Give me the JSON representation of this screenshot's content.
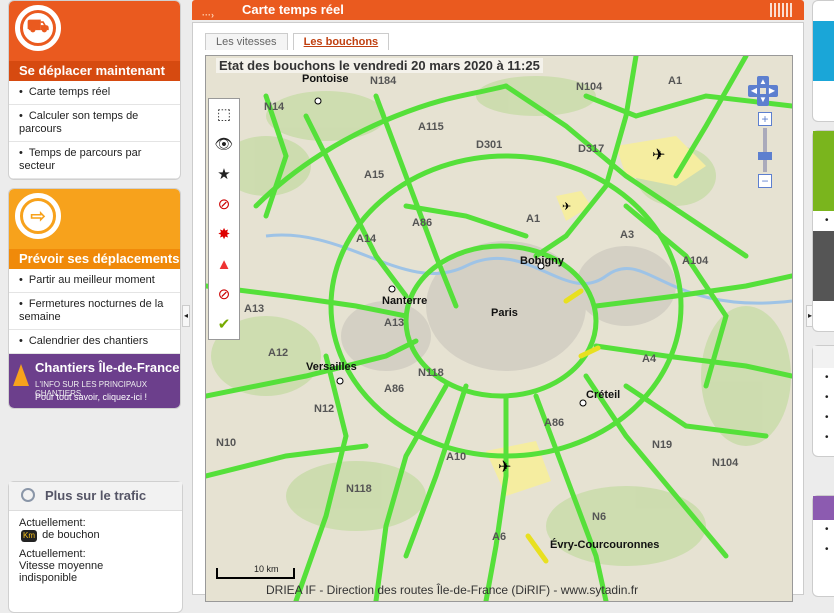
{
  "left_panel": {
    "move_now": {
      "title": "Se déplacer maintenant",
      "items": [
        "Carte temps réel",
        "Calculer son temps de parcours",
        "Temps de parcours par secteur"
      ]
    },
    "plan": {
      "title": "Prévoir ses déplacements",
      "items": [
        "Partir au meilleur moment",
        "Fermetures nocturnes de la semaine",
        "Calendrier des chantiers"
      ]
    },
    "banner": {
      "title": "Chantiers Île-de-France",
      "line1": "L'INFO SUR LES PRINCIPAUX CHANTIERS",
      "line2": "Pour tout savoir, cliquez-ici !"
    },
    "traffic": {
      "title": "Plus sur le trafic",
      "current1_label": "Actuellement:",
      "km_badge": "Km",
      "current1_text": "de bouchon",
      "current2_label": "Actuellement:",
      "current2_text1": "Vitesse moyenne",
      "current2_text2": "indisponible"
    }
  },
  "main": {
    "header_title": "Carte temps réel",
    "header_dots": "···›",
    "tabs": [
      "Les vitesses",
      "Les bouchons"
    ],
    "active_tab": "Les bouchons",
    "map_title": "Etat des bouchons le vendredi 20 mars 2020 à 11:25",
    "credit": "DRIEA IF - Direction des routes Île-de-France (DiRIF) - www.sytadin.fr",
    "scale_label": "10 km",
    "toolbar_icons": [
      "zoom-box-icon",
      "view-favorite-icon",
      "save-favorite-icon",
      "no-camera-icon",
      "incident-icon",
      "roadworks-cone-icon",
      "closure-icon",
      "check-icon"
    ],
    "places": [
      "Pontoise",
      "Bobigny",
      "Nanterre",
      "Paris",
      "Versailles",
      "Créteil",
      "Évry-Courcouronnes"
    ],
    "roads": [
      "N184",
      "A1",
      "N104",
      "N14",
      "A115",
      "D301",
      "D317",
      "A15",
      "A1",
      "A3",
      "A86",
      "A14",
      "A104",
      "A13",
      "A13",
      "A86",
      "A12",
      "N118",
      "A4",
      "N12",
      "A86",
      "N19",
      "N10",
      "A10",
      "N104",
      "N118",
      "A6",
      "N6"
    ],
    "colors": {
      "fluid": "#55e03a",
      "slow": "#e8e020",
      "airport": "#f5eda0"
    }
  }
}
